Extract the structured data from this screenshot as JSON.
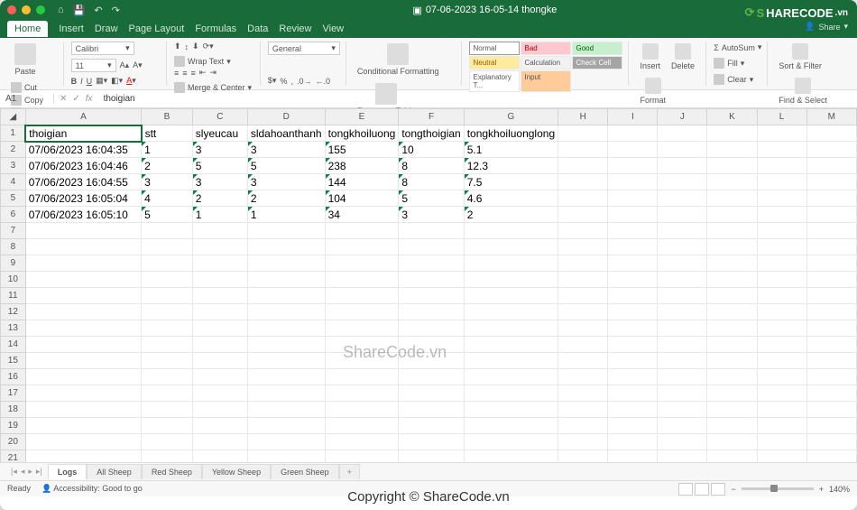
{
  "window": {
    "title": "07-06-2023 16-05-14 thongke"
  },
  "menu": {
    "items": [
      "Home",
      "Insert",
      "Draw",
      "Page Layout",
      "Formulas",
      "Data",
      "Review",
      "View"
    ],
    "active": "Home"
  },
  "ribbon": {
    "paste": "Paste",
    "cut": "Cut",
    "copy": "Copy",
    "format": "Format",
    "font": "Calibri",
    "fontsize": "11",
    "wraptext": "Wrap Text",
    "merge": "Merge & Center",
    "numfmt": "General",
    "cond": "Conditional Formatting",
    "fmttable": "Format as Table",
    "cellstyles": {
      "normal": "Normal",
      "bad": "Bad",
      "good": "Good",
      "neutral": "Neutral",
      "calc": "Calculation",
      "check": "Check Cell",
      "expl": "Explanatory T...",
      "input": "Input"
    },
    "insert": "Insert",
    "delete": "Delete",
    "formatcell": "Format",
    "autosum": "AutoSum",
    "fill": "Fill",
    "clear": "Clear",
    "sort": "Sort & Filter",
    "find": "Find & Select"
  },
  "namebox": {
    "cell": "A1",
    "fx": "fx",
    "formula": "thoigian"
  },
  "columns": [
    "A",
    "B",
    "C",
    "D",
    "E",
    "F",
    "G",
    "H",
    "I",
    "J",
    "K",
    "L",
    "M"
  ],
  "headers": [
    "thoigian",
    "stt",
    "slyeucau",
    "sldahoanthanh",
    "tongkhoiluong",
    "tongthoigian",
    "tongkhoiluonglong"
  ],
  "rows": [
    {
      "thoigian": "07/06/2023 16:04:35",
      "stt": "1",
      "slyeucau": "3",
      "sldahoanth": "3",
      "tongkhoilu": "155",
      "tongthoigia": "10",
      "tongkhoiluonglong": "5.1"
    },
    {
      "thoigian": "07/06/2023 16:04:46",
      "stt": "2",
      "slyeucau": "5",
      "sldahoanth": "5",
      "tongkhoilu": "238",
      "tongthoigia": "8",
      "tongkhoiluonglong": "12.3"
    },
    {
      "thoigian": "07/06/2023 16:04:55",
      "stt": "3",
      "slyeucau": "3",
      "sldahoanth": "3",
      "tongkhoilu": "144",
      "tongthoigia": "8",
      "tongkhoiluonglong": "7.5"
    },
    {
      "thoigian": "07/06/2023 16:05:04",
      "stt": "4",
      "slyeucau": "2",
      "sldahoanth": "2",
      "tongkhoilu": "104",
      "tongthoigia": "5",
      "tongkhoiluonglong": "4.6"
    },
    {
      "thoigian": "07/06/2023 16:05:10",
      "stt": "5",
      "slyeucau": "1",
      "sldahoanth": "1",
      "tongkhoilu": "34",
      "tongthoigia": "3",
      "tongkhoiluonglong": "2"
    }
  ],
  "tabs": [
    "Logs",
    "All Sheep",
    "Red Sheep",
    "Yellow Sheep",
    "Green Sheep"
  ],
  "activetab": "Logs",
  "status": {
    "ready": "Ready",
    "access": "Accessibility: Good to go",
    "zoom": "140%"
  },
  "watermarks": {
    "center": "ShareCode.vn",
    "copyright": "Copyright © ShareCode.vn"
  },
  "logo": {
    "pre": "S",
    "mid": "HARECODE",
    "suf": ".vn"
  },
  "share": "Share"
}
